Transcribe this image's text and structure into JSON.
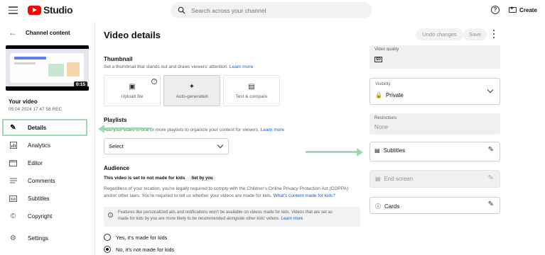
{
  "header": {
    "logo_text": "Studio",
    "search_placeholder": "Search across your channel",
    "help_glyph": "?",
    "create_label": "Create"
  },
  "sidebar": {
    "back_label": "Channel content",
    "video_duration": "0:15",
    "video_title": "Your video",
    "video_meta": "05 04 2024 17 47 58 REC",
    "items": [
      {
        "label": "Details",
        "icon": "pencil-icon"
      },
      {
        "label": "Analytics",
        "icon": "analytics-icon"
      },
      {
        "label": "Editor",
        "icon": "editor-icon"
      },
      {
        "label": "Comments",
        "icon": "comments-icon"
      },
      {
        "label": "Subtitles",
        "icon": "subtitles-icon"
      },
      {
        "label": "Copyright",
        "icon": "copyright-icon"
      },
      {
        "label": "Settings",
        "icon": "gear-icon"
      }
    ]
  },
  "main": {
    "title": "Video details",
    "undo_label": "Undo changes",
    "save_label": "Save",
    "thumbnail": {
      "heading": "Thumbnail",
      "desc": "Set a thumbnail that stands out and draws viewers' attention.",
      "learn_more": "Learn more",
      "options": [
        "Upload file",
        "Auto-generated",
        "Test & compare"
      ]
    },
    "playlists": {
      "heading": "Playlists",
      "desc": "Add your video to one or more playlists to organize your content for viewers.",
      "learn_more": "Learn more",
      "select_value": "Select"
    },
    "audience": {
      "heading": "Audience",
      "status": "This video is set to not made for kids",
      "set_by": "Set by you",
      "desc1": "Regardless of your location, you're legally required to comply with the Children's Online Privacy Protection Act (COPPA)",
      "desc2": "and/or other laws. You're required to tell us whether your videos are made for kids.",
      "desc_link": "What's content made for kids?",
      "notice1": "Features like personalized ads and notifications won't be available on videos made for kids. Videos that are set as",
      "notice2": "made for kids by you are more likely to be recommended alongside other kids' videos.",
      "notice_link": "Learn more",
      "option_yes": "Yes, it's made for kids",
      "option_no": "No, it's not made for kids"
    }
  },
  "right_panel": {
    "video_quality_label": "Video quality",
    "video_quality_badge": "SD",
    "visibility_label": "Visibility",
    "visibility_value": "Private",
    "restrictions_label": "Restrictions",
    "restrictions_value": "None",
    "subtitles_label": "Subtitles",
    "end_screen_label": "End screen",
    "cards_label": "Cards"
  },
  "colors": {
    "highlight": "#9ed9b2",
    "link": "#065fd4",
    "brand_red": "#ff0000"
  }
}
